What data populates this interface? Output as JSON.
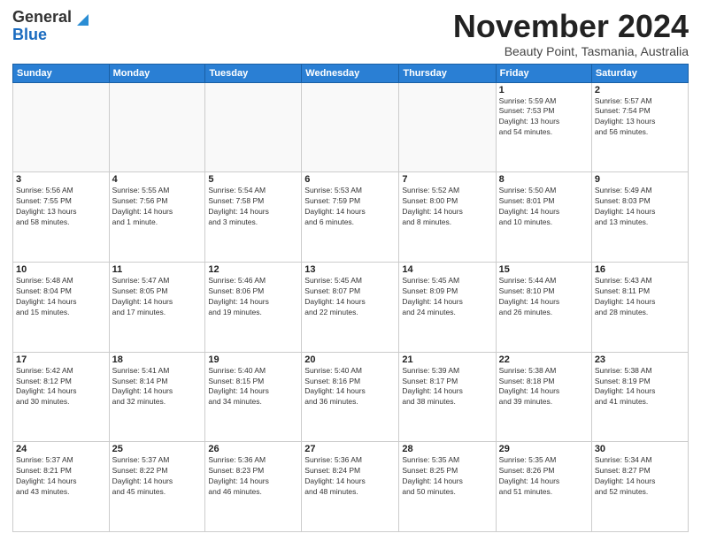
{
  "header": {
    "logo_general": "General",
    "logo_blue": "Blue",
    "month_title": "November 2024",
    "location": "Beauty Point, Tasmania, Australia"
  },
  "weekdays": [
    "Sunday",
    "Monday",
    "Tuesday",
    "Wednesday",
    "Thursday",
    "Friday",
    "Saturday"
  ],
  "weeks": [
    [
      {
        "day": "",
        "info": ""
      },
      {
        "day": "",
        "info": ""
      },
      {
        "day": "",
        "info": ""
      },
      {
        "day": "",
        "info": ""
      },
      {
        "day": "",
        "info": ""
      },
      {
        "day": "1",
        "info": "Sunrise: 5:59 AM\nSunset: 7:53 PM\nDaylight: 13 hours\nand 54 minutes."
      },
      {
        "day": "2",
        "info": "Sunrise: 5:57 AM\nSunset: 7:54 PM\nDaylight: 13 hours\nand 56 minutes."
      }
    ],
    [
      {
        "day": "3",
        "info": "Sunrise: 5:56 AM\nSunset: 7:55 PM\nDaylight: 13 hours\nand 58 minutes."
      },
      {
        "day": "4",
        "info": "Sunrise: 5:55 AM\nSunset: 7:56 PM\nDaylight: 14 hours\nand 1 minute."
      },
      {
        "day": "5",
        "info": "Sunrise: 5:54 AM\nSunset: 7:58 PM\nDaylight: 14 hours\nand 3 minutes."
      },
      {
        "day": "6",
        "info": "Sunrise: 5:53 AM\nSunset: 7:59 PM\nDaylight: 14 hours\nand 6 minutes."
      },
      {
        "day": "7",
        "info": "Sunrise: 5:52 AM\nSunset: 8:00 PM\nDaylight: 14 hours\nand 8 minutes."
      },
      {
        "day": "8",
        "info": "Sunrise: 5:50 AM\nSunset: 8:01 PM\nDaylight: 14 hours\nand 10 minutes."
      },
      {
        "day": "9",
        "info": "Sunrise: 5:49 AM\nSunset: 8:03 PM\nDaylight: 14 hours\nand 13 minutes."
      }
    ],
    [
      {
        "day": "10",
        "info": "Sunrise: 5:48 AM\nSunset: 8:04 PM\nDaylight: 14 hours\nand 15 minutes."
      },
      {
        "day": "11",
        "info": "Sunrise: 5:47 AM\nSunset: 8:05 PM\nDaylight: 14 hours\nand 17 minutes."
      },
      {
        "day": "12",
        "info": "Sunrise: 5:46 AM\nSunset: 8:06 PM\nDaylight: 14 hours\nand 19 minutes."
      },
      {
        "day": "13",
        "info": "Sunrise: 5:45 AM\nSunset: 8:07 PM\nDaylight: 14 hours\nand 22 minutes."
      },
      {
        "day": "14",
        "info": "Sunrise: 5:45 AM\nSunset: 8:09 PM\nDaylight: 14 hours\nand 24 minutes."
      },
      {
        "day": "15",
        "info": "Sunrise: 5:44 AM\nSunset: 8:10 PM\nDaylight: 14 hours\nand 26 minutes."
      },
      {
        "day": "16",
        "info": "Sunrise: 5:43 AM\nSunset: 8:11 PM\nDaylight: 14 hours\nand 28 minutes."
      }
    ],
    [
      {
        "day": "17",
        "info": "Sunrise: 5:42 AM\nSunset: 8:12 PM\nDaylight: 14 hours\nand 30 minutes."
      },
      {
        "day": "18",
        "info": "Sunrise: 5:41 AM\nSunset: 8:14 PM\nDaylight: 14 hours\nand 32 minutes."
      },
      {
        "day": "19",
        "info": "Sunrise: 5:40 AM\nSunset: 8:15 PM\nDaylight: 14 hours\nand 34 minutes."
      },
      {
        "day": "20",
        "info": "Sunrise: 5:40 AM\nSunset: 8:16 PM\nDaylight: 14 hours\nand 36 minutes."
      },
      {
        "day": "21",
        "info": "Sunrise: 5:39 AM\nSunset: 8:17 PM\nDaylight: 14 hours\nand 38 minutes."
      },
      {
        "day": "22",
        "info": "Sunrise: 5:38 AM\nSunset: 8:18 PM\nDaylight: 14 hours\nand 39 minutes."
      },
      {
        "day": "23",
        "info": "Sunrise: 5:38 AM\nSunset: 8:19 PM\nDaylight: 14 hours\nand 41 minutes."
      }
    ],
    [
      {
        "day": "24",
        "info": "Sunrise: 5:37 AM\nSunset: 8:21 PM\nDaylight: 14 hours\nand 43 minutes."
      },
      {
        "day": "25",
        "info": "Sunrise: 5:37 AM\nSunset: 8:22 PM\nDaylight: 14 hours\nand 45 minutes."
      },
      {
        "day": "26",
        "info": "Sunrise: 5:36 AM\nSunset: 8:23 PM\nDaylight: 14 hours\nand 46 minutes."
      },
      {
        "day": "27",
        "info": "Sunrise: 5:36 AM\nSunset: 8:24 PM\nDaylight: 14 hours\nand 48 minutes."
      },
      {
        "day": "28",
        "info": "Sunrise: 5:35 AM\nSunset: 8:25 PM\nDaylight: 14 hours\nand 50 minutes."
      },
      {
        "day": "29",
        "info": "Sunrise: 5:35 AM\nSunset: 8:26 PM\nDaylight: 14 hours\nand 51 minutes."
      },
      {
        "day": "30",
        "info": "Sunrise: 5:34 AM\nSunset: 8:27 PM\nDaylight: 14 hours\nand 52 minutes."
      }
    ]
  ]
}
